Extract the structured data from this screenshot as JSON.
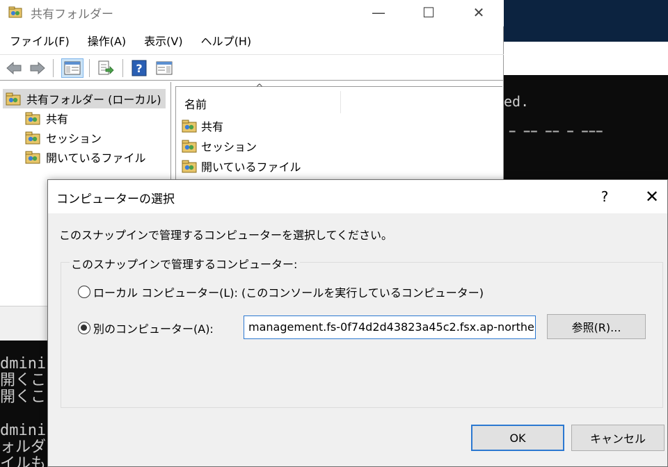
{
  "window": {
    "title": "共有フォルダー",
    "minimize_glyph": "—",
    "maximize_glyph": "☐",
    "close_glyph": "✕"
  },
  "menu": [
    {
      "label": "ファイル(F)"
    },
    {
      "label": "操作(A)"
    },
    {
      "label": "表示(V)"
    },
    {
      "label": "ヘルプ(H)"
    }
  ],
  "toolbar": {
    "icons": [
      "back-arrow-icon",
      "forward-arrow-icon",
      "show-hide-tree-icon",
      "export-list-icon",
      "help-icon",
      "show-action-pane-icon"
    ],
    "help_glyph": "?"
  },
  "tree": {
    "root": "共有フォルダー (ローカル)",
    "children": [
      "共有",
      "セッション",
      "開いているファイル"
    ]
  },
  "list": {
    "column_name": "名前",
    "sort_glyph": "^",
    "items": [
      "共有",
      "セッション",
      "開いているファイル"
    ]
  },
  "background": {
    "console_right_text": "ed.",
    "console_left_lines": [
      "dminis",
      "開くこ",
      "開くこ",
      "",
      "dminis",
      "ォルダ",
      "イルも"
    ]
  },
  "dialog": {
    "title": "コンピューターの選択",
    "help_glyph": "?",
    "close_glyph": "✕",
    "instruction": "このスナップインで管理するコンピューターを選択してください。",
    "group_label": "このスナップインで管理するコンピューター:",
    "radio_local": "ローカル コンピューター(L): (このコンソールを実行しているコンピューター)",
    "radio_other": "別のコンピューター(A):",
    "selected": "other",
    "computer_value": "management.fs-0f74d2d43823a45c2.fsx.ap-northe",
    "browse_label": "参照(R)...",
    "ok_label": "OK",
    "cancel_label": "キャンセル"
  },
  "colors": {
    "accent": "#2b78d1",
    "dialog_bg": "#f0f0f0",
    "console_bg": "#0c0c0c",
    "bg_window_header": "#0c2340"
  }
}
